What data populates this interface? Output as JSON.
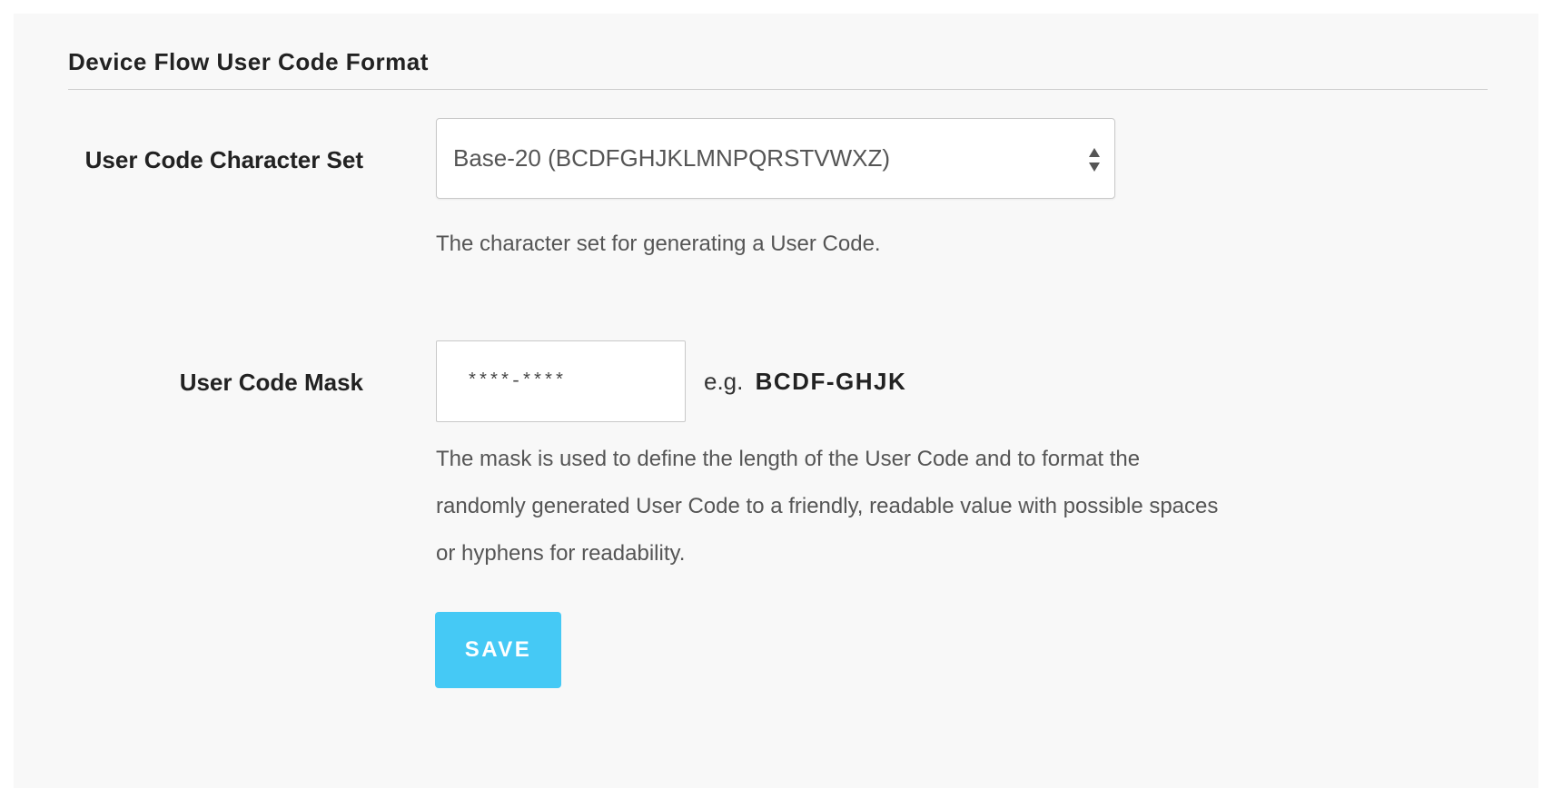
{
  "section": {
    "title": "Device Flow User Code Format"
  },
  "charset_field": {
    "label": "User Code Character Set",
    "selected_value": "Base-20 (BCDFGHJKLMNPQRSTVWXZ)",
    "help": "The character set for generating a User Code."
  },
  "mask_field": {
    "label": "User Code Mask",
    "value": "****-****",
    "example_prefix": "e.g.",
    "example_code": "BCDF-GHJK",
    "help": "The mask is used to define the length of the User Code and to format the randomly generated User Code to a friendly, readable value with possible spaces or hyphens for readability."
  },
  "actions": {
    "save_label": "SAVE"
  },
  "colors": {
    "accent": "#45c9f5",
    "panel_background": "#f8f8f8"
  },
  "icons": {
    "select_arrows": "sort-arrows-icon"
  }
}
